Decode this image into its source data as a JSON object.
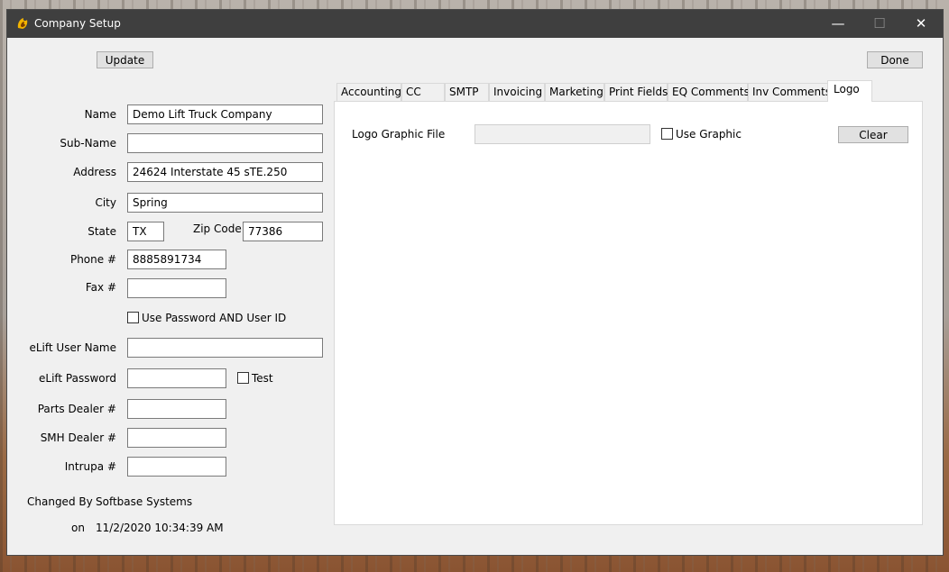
{
  "window": {
    "title": "Company Setup",
    "minimize": "—",
    "maximize": "☐",
    "close": "✕"
  },
  "buttons": {
    "update": "Update",
    "done": "Done",
    "clear": "Clear"
  },
  "form": {
    "name_label": "Name",
    "name_value": "Demo Lift Truck Company",
    "subname_label": "Sub-Name",
    "subname_value": "",
    "address_label": "Address",
    "address_value": "24624 Interstate 45 sTE.250",
    "city_label": "City",
    "city_value": "Spring",
    "state_label": "State",
    "state_value": "TX",
    "zip_label": "Zip Code",
    "zip_value": "77386",
    "phone_label": "Phone #",
    "phone_value": "8885891734",
    "fax_label": "Fax #",
    "fax_value": "",
    "use_password_label": "Use Password AND User ID",
    "elift_user_label": "eLift User Name",
    "elift_user_value": "",
    "elift_password_label": "eLift Password",
    "elift_password_value": "",
    "test_label": "Test",
    "parts_dealer_label": "Parts Dealer #",
    "parts_dealer_value": "",
    "smh_dealer_label": "SMH Dealer #",
    "smh_dealer_value": "",
    "intrupa_label": "Intrupa #",
    "intrupa_value": ""
  },
  "changed": {
    "by_label": "Changed By",
    "by_value": "Softbase Systems",
    "on_label": "on",
    "on_value": "11/2/2020 10:34:39 AM"
  },
  "tabs": [
    "Accounting",
    "CC",
    "SMTP",
    "Invoicing",
    "Marketing",
    "Print Fields",
    "EQ Comments",
    "Inv Comments",
    "Logo"
  ],
  "active_tab": "Logo",
  "logo_tab": {
    "file_label": "Logo Graphic File",
    "file_value": "",
    "use_graphic_label": "Use Graphic"
  }
}
